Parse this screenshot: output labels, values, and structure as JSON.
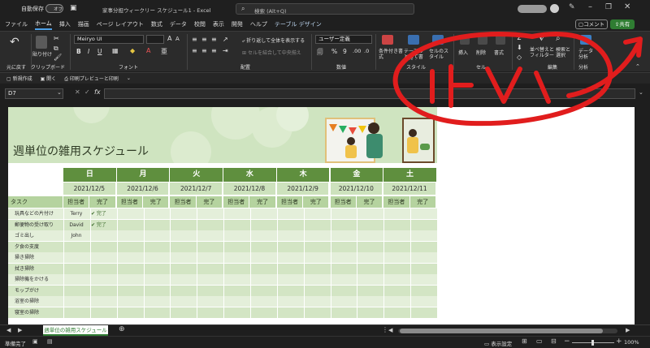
{
  "titlebar": {
    "autosave_label": "自動保存",
    "autosave_state": "オフ",
    "doc_title": "家事分担ウィークリー スケジュール1 - Excel",
    "search_placeholder": "検索 (Alt+Q)"
  },
  "tabs": [
    "ファイル",
    "ホーム",
    "挿入",
    "描画",
    "ページ レイアウト",
    "数式",
    "データ",
    "校閲",
    "表示",
    "開発",
    "ヘルプ",
    "テーブル デザイン"
  ],
  "active_tab": 1,
  "comment_button": "コメント",
  "share_button": "共有",
  "ribbon": {
    "undo_label": "元に戻す",
    "paste_label": "貼り付け",
    "clipboard_group": "クリップボード",
    "font_name": "Meiryo UI",
    "font_group": "フォント",
    "wrap_text": "折り返して全体を表示する",
    "merge_center": "セルを結合して中央揃え",
    "alignment_group": "配置",
    "number_format": "ユーザー定義",
    "number_group": "数値",
    "conditional_format": "条件付き書式",
    "table_format": "テーブルとして書式設定",
    "cell_styles": "セルのスタイル",
    "styles_group": "スタイル",
    "insert": "挿入",
    "delete": "削除",
    "format": "書式",
    "cells_group": "セル",
    "sort_filter": "並べ替えとフィルター",
    "find_select": "検索と選択",
    "editing_group": "編集",
    "data_analysis": "データ分析",
    "analysis_group": "分析"
  },
  "qat": [
    "新規作成",
    "開く",
    "印刷プレビューと印刷"
  ],
  "namebox": "D7",
  "sheet": {
    "title": "週単位の雑用スケジュール",
    "task_header": "タスク",
    "days": [
      {
        "day": "日",
        "date": "2021/12/5"
      },
      {
        "day": "月",
        "date": "2021/12/6"
      },
      {
        "day": "火",
        "date": "2021/12/7"
      },
      {
        "day": "水",
        "date": "2021/12/8"
      },
      {
        "day": "木",
        "date": "2021/12/9"
      },
      {
        "day": "金",
        "date": "2021/12/10"
      },
      {
        "day": "土",
        "date": "2021/12/11"
      }
    ],
    "sub_assignee": "担当者",
    "sub_done": "完了",
    "tasks": [
      {
        "name": "玩具などの片付け",
        "assignee": "Terry",
        "done": "✔ 完了"
      },
      {
        "name": "郵便物の受け取り",
        "assignee": "David",
        "done": "✔ 完了"
      },
      {
        "name": "ゴミ出し",
        "assignee": "John",
        "done": ""
      },
      {
        "name": "夕食の支度",
        "assignee": "",
        "done": ""
      },
      {
        "name": "掃き掃除",
        "assignee": "",
        "done": ""
      },
      {
        "name": "拭き掃除",
        "assignee": "",
        "done": ""
      },
      {
        "name": "掃除機をかける",
        "assignee": "",
        "done": ""
      },
      {
        "name": "モップがけ",
        "assignee": "",
        "done": ""
      },
      {
        "name": "浴室の掃除",
        "assignee": "",
        "done": ""
      },
      {
        "name": "寝室の掃除",
        "assignee": "",
        "done": ""
      }
    ]
  },
  "sheet_tab": "週単位の雑用スケジュール",
  "status": {
    "ready": "準備完了",
    "display_settings": "表示設定",
    "zoom": "100%"
  },
  "colors": {
    "accent_green": "#5f8f3e",
    "annotation_red": "#e11d1d"
  }
}
